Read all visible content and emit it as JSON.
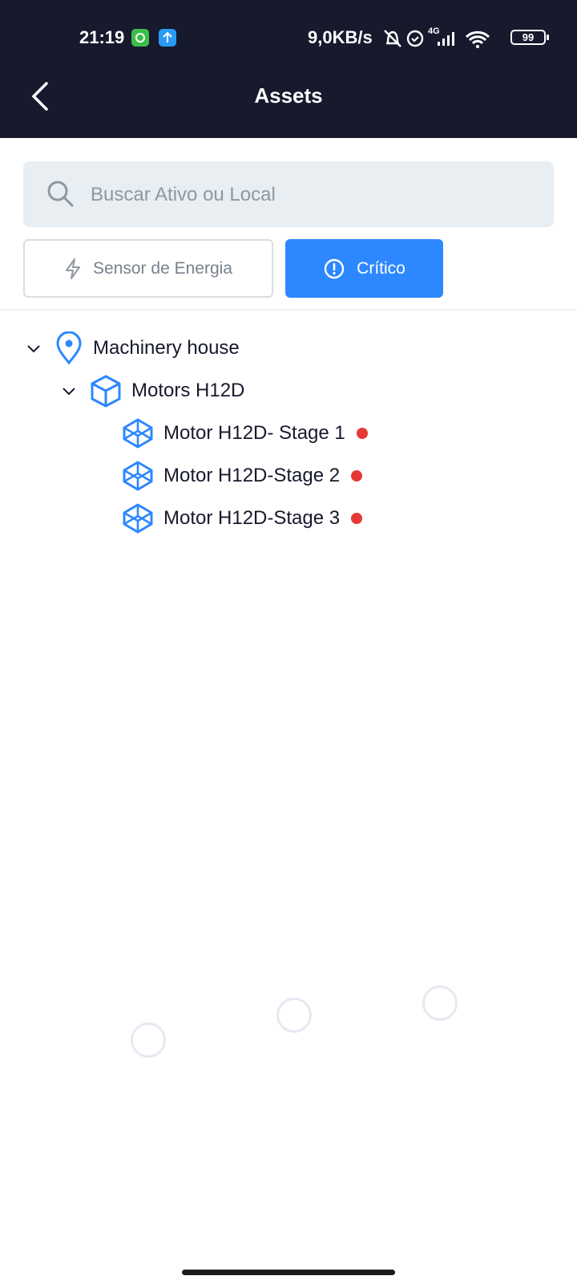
{
  "status_bar": {
    "time": "21:19",
    "network_speed": "9,0KB/s",
    "network_type": "4G",
    "battery": "99"
  },
  "header": {
    "title": "Assets",
    "background": "#17192d"
  },
  "search": {
    "placeholder": "Buscar Ativo ou Local"
  },
  "filters": {
    "energy_label": "Sensor de Energia",
    "critical_label": "Crítico",
    "active": "critical",
    "accent": "#2d88ff"
  },
  "tree": {
    "location": {
      "label": "Machinery house",
      "icon": "location-pin-icon",
      "expanded": true
    },
    "asset": {
      "label": "Motors H12D",
      "icon": "cube-icon",
      "expanded": true
    },
    "components": [
      {
        "label": "Motor H12D- Stage 1",
        "icon": "component-icon",
        "status": "critical"
      },
      {
        "label": "Motor H12D-Stage 2",
        "icon": "component-icon",
        "status": "critical"
      },
      {
        "label": "Motor H12D-Stage 3",
        "icon": "component-icon",
        "status": "critical"
      }
    ],
    "icon_color": "#2d88ff",
    "critical_color": "#e53935"
  }
}
